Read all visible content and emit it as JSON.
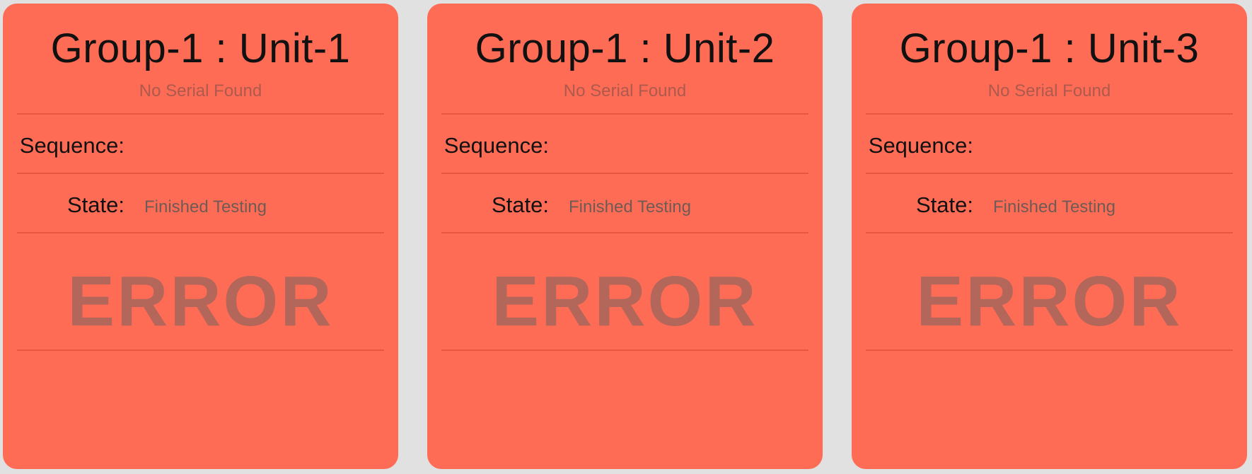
{
  "colors": {
    "background": "#e1e1e1",
    "card": "#ff6c55",
    "divider": "#e9563f",
    "status_text": "#b3665a",
    "muted_text": "#ac5a4e"
  },
  "cards": [
    {
      "title": "Group-1 : Unit-1",
      "serial": "No Serial Found",
      "sequence_label": "Sequence:",
      "sequence_value": "",
      "state_label": "State:",
      "state_value": "Finished Testing",
      "status": "ERROR"
    },
    {
      "title": "Group-1 : Unit-2",
      "serial": "No Serial Found",
      "sequence_label": "Sequence:",
      "sequence_value": "",
      "state_label": "State:",
      "state_value": "Finished Testing",
      "status": "ERROR"
    },
    {
      "title": "Group-1 : Unit-3",
      "serial": "No Serial Found",
      "sequence_label": "Sequence:",
      "sequence_value": "",
      "state_label": "State:",
      "state_value": "Finished Testing",
      "status": "ERROR"
    }
  ]
}
